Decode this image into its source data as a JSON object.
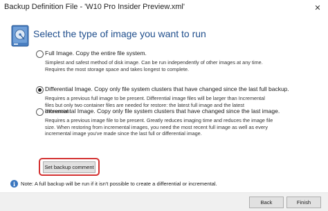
{
  "window": {
    "title": "Backup Definition File - 'W10 Pro Insider Preview.xml'",
    "close_symbol": "✕"
  },
  "heading": "Select the type of image you want to run",
  "icons": {
    "disk": "disk-drive-icon",
    "info": "info-icon",
    "info_glyph": "i"
  },
  "options": [
    {
      "label": "Full Image.  Copy the entire file system.",
      "selected": false,
      "description": [
        "Simplest and safest method of disk image. Can be run independently of other images at any time.",
        "Requires the most storage space and takes longest to complete."
      ]
    },
    {
      "label": "Differential Image.  Copy only file system clusters that have changed since the last full backup.",
      "selected": true,
      "description": [
        "Requires a previous full image to be present. Differential image files will be larger than Incremental",
        "files but only two container files are needed for restore: the latest full image and the latest",
        "differential."
      ]
    },
    {
      "label": "Incremental Image.  Copy only file system clusters that have changed since the last image.",
      "selected": false,
      "description": [
        "Requires a previous image file to be present. Greatly reduces imaging time and reduces the image file",
        "size. When restoring from incremental images, you need the most recent full image as well as every",
        "incremental image you've made since the last full or differential image."
      ]
    }
  ],
  "buttons": {
    "set_backup_comment": "Set backup comment",
    "back": "Back",
    "finish": "Finish"
  },
  "note": "Note:  A full backup will be run if it isn't possible to create a differential or incremental.",
  "colors": {
    "heading": "#1f4e8c",
    "highlight": "#d32f2f",
    "info": "#3b77bf",
    "footer": "#f0f0f0"
  }
}
